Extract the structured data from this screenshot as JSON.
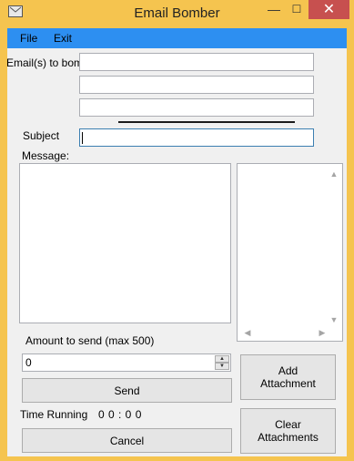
{
  "window": {
    "title": "Email Bomber",
    "controls": {
      "minimize": "—",
      "maximize": "☐",
      "close": "✕"
    }
  },
  "menu": {
    "file": "File",
    "exit": "Exit"
  },
  "form": {
    "emails_label": "Email(s) to bomb",
    "email_fields": [
      "",
      "",
      ""
    ],
    "subject_label": "Subject",
    "subject_value": "",
    "message_label": "Message:",
    "message_value": "",
    "amount_label": "Amount to send (max 500)",
    "amount_value": "0",
    "time_running_label": "Time Running",
    "time_running_value": "0 0 : 0 0"
  },
  "buttons": {
    "send": "Send",
    "cancel": "Cancel",
    "add_attachment": "Add\nAttachment",
    "clear_attachments": "Clear\nAttachments"
  },
  "attachments": {
    "items": []
  },
  "icons": {
    "app": "envelope-icon",
    "scroll_up": "chevron-up-icon",
    "scroll_down": "chevron-down-icon",
    "scroll_left": "chevron-left-icon",
    "scroll_right": "chevron-right-icon",
    "spin_up": "spin-up-icon",
    "spin_down": "spin-down-icon"
  },
  "colors": {
    "title_bar": "#f5c44f",
    "menu_bar": "#2d8ff1",
    "close_button": "#c7504f",
    "client_bg": "#f0f0f0"
  }
}
